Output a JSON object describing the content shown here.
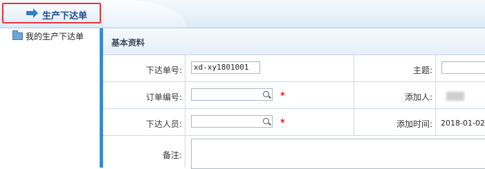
{
  "header": {
    "title": "生产下达单"
  },
  "sidebar": {
    "items": [
      {
        "label": "我的生产下达单"
      }
    ]
  },
  "form": {
    "section_title": "基本资料",
    "order_no_label": "下达单号:",
    "order_no_value": "xd-xy1801001",
    "subject_label": "主题:",
    "subject_value": "",
    "po_label": "订单编号:",
    "po_value": "",
    "adder_label": "添加人:",
    "issuer_label": "下达人员:",
    "issuer_value": "",
    "added_time_label": "添加时间:",
    "added_time_value": "2018-01-02",
    "remark_label": "备注:",
    "remark_value": "",
    "required_mark": "*"
  },
  "colors": {
    "accent": "#3b8bd1",
    "highlight_border": "#e0343f",
    "required": "#e01b1b"
  }
}
